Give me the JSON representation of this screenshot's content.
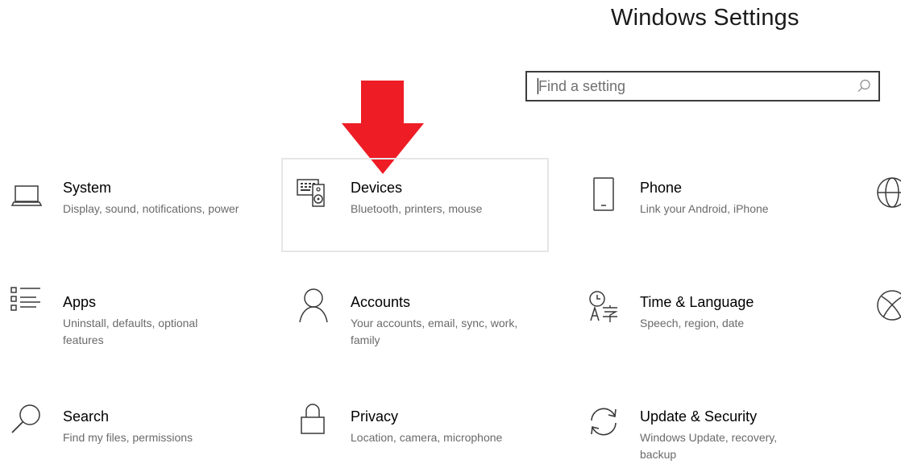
{
  "header": {
    "title": "Windows Settings"
  },
  "search": {
    "placeholder": "Find a setting",
    "value": "",
    "icon": "search-icon"
  },
  "annotation": {
    "type": "arrow",
    "color": "#ee1c25",
    "points_to": "Devices"
  },
  "categories": [
    {
      "name": "System",
      "description": "Display, sound, notifications, power",
      "icon": "laptop-icon"
    },
    {
      "name": "Devices",
      "description": "Bluetooth, printers, mouse",
      "icon": "keyboard-speaker-icon",
      "state": "hover"
    },
    {
      "name": "Phone",
      "description": "Link your Android, iPhone",
      "icon": "phone-icon"
    },
    {
      "name": "Network & Internet",
      "description": "",
      "icon": "globe-icon",
      "state": "partially-visible"
    },
    {
      "name": "Apps",
      "description": "Uninstall, defaults, optional features",
      "icon": "apps-list-icon"
    },
    {
      "name": "Accounts",
      "description": "Your accounts, email, sync, work, family",
      "icon": "person-icon"
    },
    {
      "name": "Time & Language",
      "description": "Speech, region, date",
      "icon": "clock-language-icon"
    },
    {
      "name": "Gaming",
      "description": "",
      "icon": "xbox-icon",
      "state": "partially-visible"
    },
    {
      "name": "Search",
      "description": "Find my files, permissions",
      "icon": "magnifier-icon"
    },
    {
      "name": "Privacy",
      "description": "Location, camera, microphone",
      "icon": "lock-icon"
    },
    {
      "name": "Update & Security",
      "description": "Windows Update, recovery, backup",
      "icon": "sync-arrows-icon"
    }
  ],
  "colors": {
    "background": "#ffffff",
    "text": "#000000",
    "secondary_text": "#6a6a6a",
    "icon_stroke": "#3a3a3a",
    "hover_border": "#e6e6e6",
    "arrow": "#ee1c25"
  }
}
